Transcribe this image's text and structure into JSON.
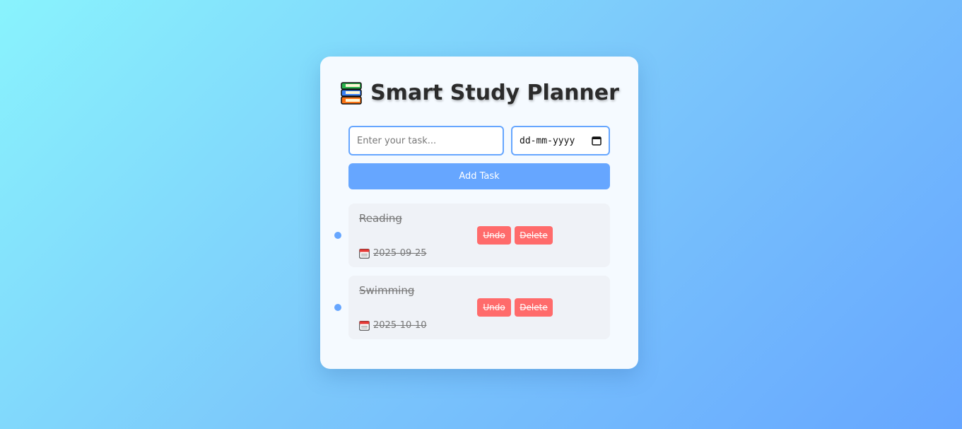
{
  "app": {
    "title": "Smart Study Planner"
  },
  "form": {
    "task_placeholder": "Enter your task...",
    "task_value": "",
    "date_placeholder": "dd-mm-yyyy",
    "add_label": "Add Task"
  },
  "tasks": [
    {
      "name": "Reading",
      "date": "2025-09-25",
      "undo_label": "Undo",
      "delete_label": "Delete",
      "completed": true
    },
    {
      "name": "Swimming",
      "date": "2025-10-10",
      "undo_label": "Undo",
      "delete_label": "Delete",
      "completed": true
    }
  ],
  "colors": {
    "accent": "#66a6ff",
    "danger": "#ff6b6b",
    "card_bg": "#f5faff",
    "item_bg": "#eff2f7"
  },
  "icons": {
    "title_icon": "books-icon",
    "date_icon": "calendar-icon",
    "date_picker_icon": "calendar-picker-icon"
  }
}
